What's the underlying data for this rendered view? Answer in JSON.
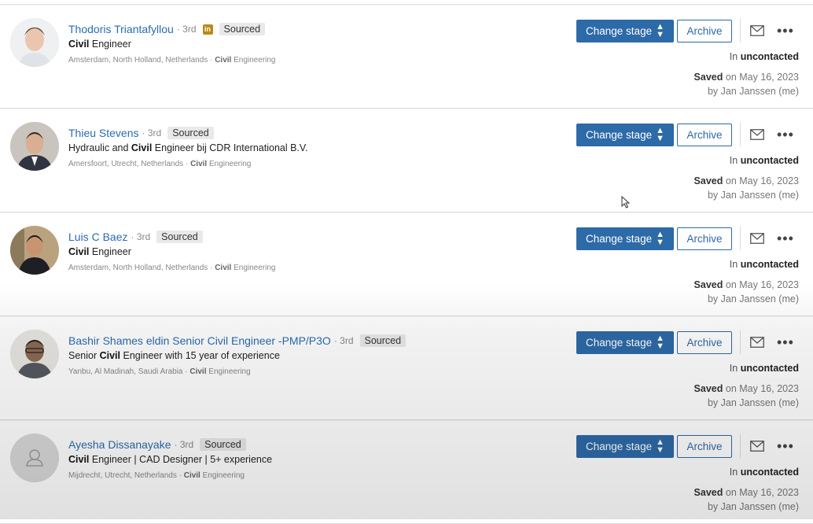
{
  "labels": {
    "change_stage": "Change stage",
    "archive": "Archive",
    "more": "•••",
    "stage_prefix": "In",
    "saved_label": "Saved",
    "saved_on": "on May 16, 2023",
    "saved_by": "by Jan Janssen (me)"
  },
  "candidates": [
    {
      "name": "Thodoris Triantafyllou",
      "degree": "· 3rd",
      "linkedin_badge": "in",
      "tag": "Sourced",
      "headline_bold": "Civil",
      "headline_rest": " Engineer",
      "location": "Amsterdam, North Holland, Netherlands · ",
      "industry_bold": "Civil",
      "industry_rest": " Engineering",
      "stage": "uncontacted"
    },
    {
      "name": "Thieu Stevens",
      "degree": "· 3rd",
      "tag": "Sourced",
      "headline_pre": "Hydraulic and ",
      "headline_bold": "Civil",
      "headline_rest": " Engineer bij CDR International B.V.",
      "location": "Amersfoort, Utrecht, Netherlands · ",
      "industry_bold": "Civil",
      "industry_rest": " Engineering",
      "stage": "uncontacted"
    },
    {
      "name": "Luis C Baez",
      "degree": "· 3rd",
      "tag": "Sourced",
      "headline_bold": "Civil",
      "headline_rest": " Engineer",
      "location": "Amsterdam, North Holland, Netherlands · ",
      "industry_bold": "Civil",
      "industry_rest": " Engineering",
      "stage": "uncontacted"
    },
    {
      "name": "Bashir Shames eldin Senior Civil Engineer -PMP/P3O",
      "degree": "· 3rd",
      "tag": "Sourced",
      "headline_pre": "Senior ",
      "headline_bold": "Civil",
      "headline_rest": " Engineer with 15 year of experience",
      "location": "Yanbu, Al Madinah, Saudi Arabia · ",
      "industry_bold": "Civil",
      "industry_rest": " Engineering",
      "stage": "uncontacted"
    },
    {
      "name": "Ayesha Dissanayake",
      "degree": "· 3rd",
      "tag": "Sourced",
      "headline_bold": "Civil",
      "headline_rest": " Engineer | CAD Designer | 5+ experience",
      "location": "Mijdrecht, Utrecht, Netherlands · ",
      "industry_bold": "Civil",
      "industry_rest": " Engineering",
      "stage": "uncontacted"
    }
  ],
  "colors": {
    "primary_button": "#2d6aa8",
    "name_link": "#2b6cb0",
    "linkedin_badge": "#b98a1a"
  }
}
